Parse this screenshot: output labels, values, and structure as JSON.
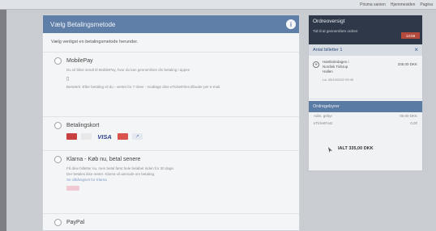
{
  "topbar": {
    "bookmarks": [
      "Prisma sanien",
      "Hjemmesiden",
      "Pagina"
    ]
  },
  "payment": {
    "header": "Vælg Betalingsmetode",
    "subtitle": "Vælg venligst en betalingsmetode herunder.",
    "options": {
      "mobilepay": {
        "title": "MobilePay",
        "desc": "Du vil blive sendt til MobilePay, hvor du kan gennemføre din betaling i appen",
        "note": "Bemærk: Efter betaling vil du - ventet for 7 timer - modtage dine eTicketFiles tilbuder per e-mail."
      },
      "card": {
        "title": "Betalingskort",
        "brands": [
          "Dankort",
          "MC",
          "VISA",
          "Maestro",
          "Card"
        ]
      },
      "klarna": {
        "title": "Klarna - Køb nu, betal senere",
        "desc_1": "Få dine billetter nu, men betal først hele beløbet inden for 30 dage.",
        "desc_2": "Der betales ikke renter. Klarna vil anmode om betaling.",
        "desc_3": "Se vilkårsgivet for Klarna"
      },
      "last": {
        "title": "PayPal"
      }
    }
  },
  "summary": {
    "title": "Ordreoversigt",
    "subtitle": "Tid til at gennemføre ordren",
    "timer": "14:59",
    "tickets_header": "Antal billetter 1",
    "ticket": {
      "name_1": "Høstkoledagen i",
      "name_2": "Nordisk Tidsrup",
      "name_3": "Hallen",
      "price": "335,00 DKK",
      "date": "Lø. 28/10/2022 09:45"
    },
    "fees_header": "Ordregebyrer",
    "fees": [
      {
        "label": "Adm. gebyr",
        "value": "00,00 DKK"
      },
      {
        "label": "eTicketFast",
        "value": "0,00"
      }
    ],
    "total": "IALT 335,00 DKK"
  }
}
